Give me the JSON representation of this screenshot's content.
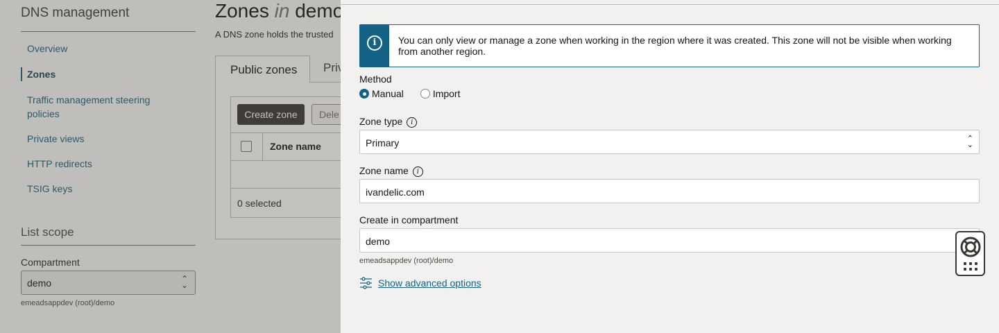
{
  "sidebar": {
    "title": "DNS management",
    "items": [
      {
        "label": "Overview"
      },
      {
        "label": "Zones"
      },
      {
        "label": "Traffic management steering policies"
      },
      {
        "label": "Private views"
      },
      {
        "label": "HTTP redirects"
      },
      {
        "label": "TSIG keys"
      }
    ],
    "scope_title": "List scope",
    "compartment_label": "Compartment",
    "compartment_value": "demo",
    "compartment_path": "emeadsappdev (root)/demo"
  },
  "main": {
    "title_prefix": "Zones",
    "title_in": "in",
    "title_suffix": "demo",
    "description": "A DNS zone holds the trusted",
    "tabs": [
      {
        "label": "Public zones"
      },
      {
        "label": "Priv"
      }
    ],
    "create_button": "Create zone",
    "delete_button": "Dele",
    "column_zone_name": "Zone name",
    "selected_count": "0 selected"
  },
  "drawer": {
    "notice": "You can only view or manage a zone when working in the region where it was created. This zone will not be visible when working from another region.",
    "method_label": "Method",
    "method_options": [
      {
        "label": "Manual",
        "selected": true
      },
      {
        "label": "Import",
        "selected": false
      }
    ],
    "zone_type_label": "Zone type",
    "zone_type_value": "Primary",
    "zone_name_label": "Zone name",
    "zone_name_value": "ivandelic.com",
    "compartment_label": "Create in compartment",
    "compartment_value": "demo",
    "compartment_path": "emeadsappdev (root)/demo",
    "advanced_link": "Show advanced options"
  },
  "colors": {
    "accent": "#136386",
    "link": "#1f5e78",
    "primary_button": "#3a3632"
  },
  "icons": {
    "notice": "info-icon",
    "field_info": "info-circle-icon",
    "advanced": "sliders-icon",
    "help": "lifebuoy-icon",
    "apps": "grid-icon"
  }
}
